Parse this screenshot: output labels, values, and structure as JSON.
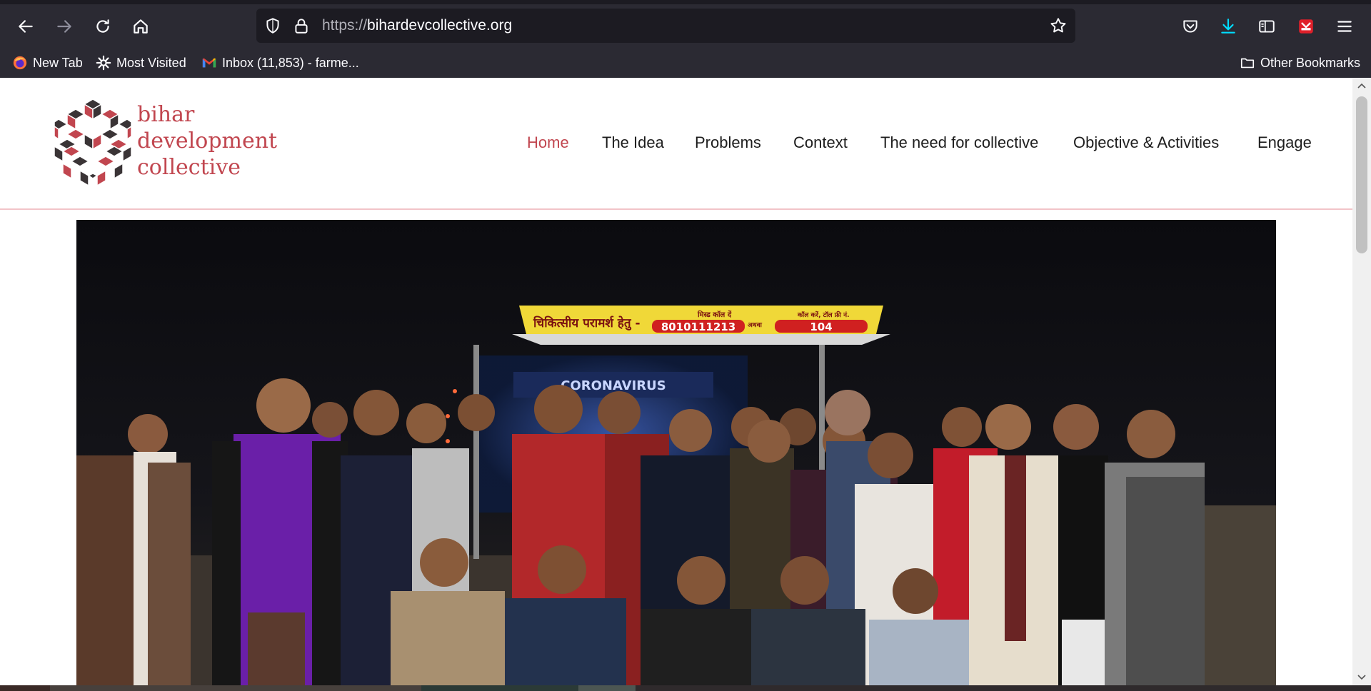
{
  "browser": {
    "url_prefix": "https://",
    "url_domain": "bihardevcollective.org",
    "icons": [
      "back-icon",
      "forward-icon",
      "reload-icon",
      "home-icon",
      "shield-icon",
      "lock-icon",
      "star-icon",
      "pocket-icon",
      "download-icon",
      "sidebar-icon",
      "extension-icon",
      "menu-icon"
    ],
    "accent_color": "#00ddff"
  },
  "bookmarks": {
    "items": [
      {
        "label": "New Tab",
        "icon": "firefox-icon"
      },
      {
        "label": "Most Visited",
        "icon": "gear-icon"
      },
      {
        "label": "Inbox (11,853) - farme...",
        "icon": "gmail-icon"
      }
    ],
    "other_label": "Other Bookmarks"
  },
  "site": {
    "logo_lines": [
      "bihar",
      "development",
      "collective"
    ],
    "brand_color": "#c1464f",
    "nav": [
      {
        "label": "Home",
        "active": true
      },
      {
        "label": "The Idea",
        "active": false
      },
      {
        "label": "Problems",
        "active": false
      },
      {
        "label": "Context",
        "active": false
      },
      {
        "label": "The need for collective",
        "active": false
      },
      {
        "label": "Objective & Activities",
        "active": false
      },
      {
        "label": "Engage",
        "active": false
      }
    ],
    "hero": {
      "sign_left": "चिकित्सीय परामर्श हेतु -",
      "sign_call": "मिस्ड कॉल दें",
      "sign_number": "8010111213",
      "sign_or": "अथवा",
      "sign_toll": "कॉल करें, टॉल फ्री नं.",
      "sign_toll_number": "104",
      "banner_text": "CORONAVIRUS"
    }
  }
}
